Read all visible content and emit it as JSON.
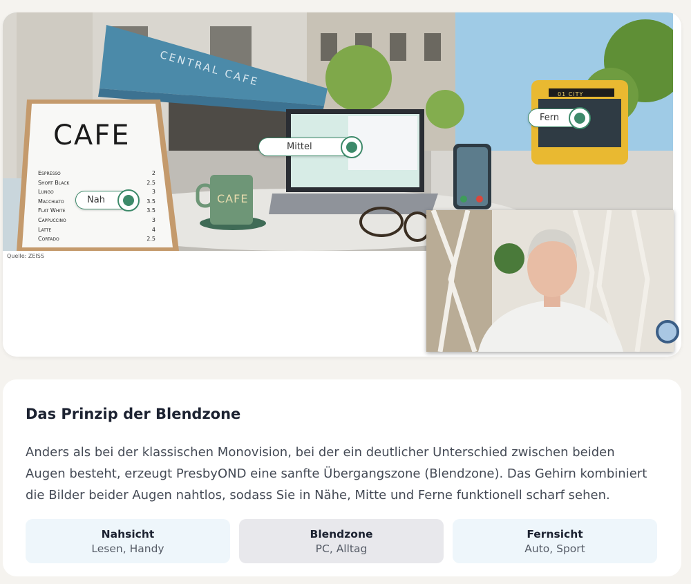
{
  "video": {
    "source_credit": "Quelle: ZEISS",
    "cafe_sign": "CAFE",
    "mug_text": "CAFE",
    "awning_text": "CENTRAL CAFE",
    "bus_text": "01 CITY",
    "menu": [
      {
        "item": "Espresso",
        "price": "2"
      },
      {
        "item": "Short Black",
        "price": "2.5"
      },
      {
        "item": "Lungo",
        "price": "3"
      },
      {
        "item": "Macchiato",
        "price": "3.5"
      },
      {
        "item": "Flat White",
        "price": "3.5"
      },
      {
        "item": "Cappuccino",
        "price": "3"
      },
      {
        "item": "Latte",
        "price": "4"
      },
      {
        "item": "Cortado",
        "price": "2.5"
      }
    ],
    "tags": {
      "near": "Nah",
      "mid": "Mittel",
      "far": "Fern"
    }
  },
  "info": {
    "title": "Das Prinzip der Blendzone",
    "text": "Anders als bei der klassischen Monovision, bei der ein deutlicher Unterschied zwischen beiden Augen besteht, erzeugt PresbyOND eine sanfte Übergangszone (Blendzone). Das Gehirn kombiniert die Bilder beider Augen nahtlos, sodass Sie in Nähe, Mitte und Ferne funktionell scharf sehen.",
    "zones": [
      {
        "title": "Nahsicht",
        "subtitle": "Lesen, Handy"
      },
      {
        "title": "Blendzone",
        "subtitle": "PC, Alltag"
      },
      {
        "title": "Fernsicht",
        "subtitle": "Auto, Sport"
      }
    ]
  }
}
